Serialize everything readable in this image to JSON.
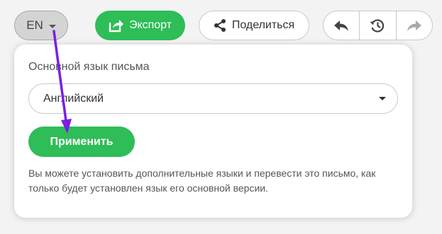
{
  "toolbar": {
    "language_code": "EN",
    "export_label": "Экспорт",
    "share_label": "Поделиться",
    "history_icons": [
      "undo-icon",
      "history-icon",
      "redo-icon"
    ]
  },
  "language_panel": {
    "label": "Основной язык письма",
    "selected_language": "Английский",
    "apply_label": "Применить",
    "note": "Вы можете установить дополнительные языки и перевести это письмо, как только будет установлен язык его основной версии."
  },
  "colors": {
    "accent_green": "#2ebd57",
    "annotation_arrow": "#7b1fe3",
    "background": "#f3f3f3"
  }
}
